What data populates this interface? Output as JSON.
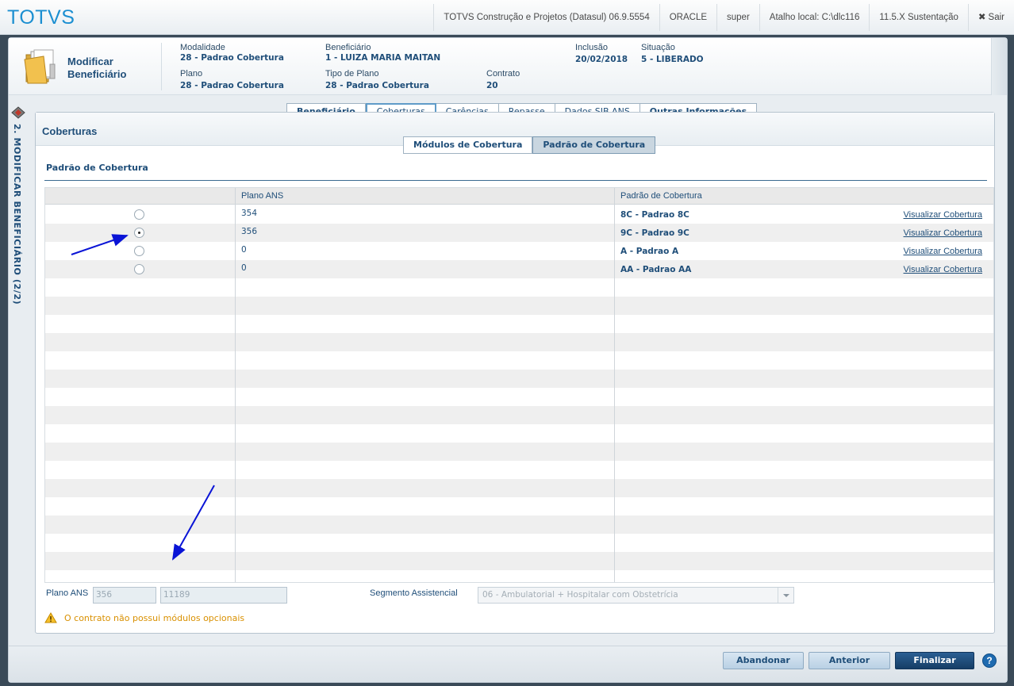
{
  "topbar": {
    "logo": "TOTVS",
    "items": [
      "TOTVS Construção e Projetos (Datasul) 06.9.5554",
      "ORACLE",
      "super",
      "Atalho local: C:\\dlc116",
      "11.5.X Sustentação"
    ],
    "exit_label": "Sair"
  },
  "header": {
    "title_line1": "Modificar",
    "title_line2": "Beneficiário",
    "fields": {
      "modalidade": {
        "label": "Modalidade",
        "value": "28 - Padrao Cobertura"
      },
      "beneficiario": {
        "label": "Beneficiário",
        "value": "1 - LUIZA MARIA MAITAN"
      },
      "inclusao": {
        "label": "Inclusão",
        "value": "20/02/2018"
      },
      "situacao": {
        "label": "Situação",
        "value": "5 - LIBERADO"
      },
      "plano": {
        "label": "Plano",
        "value": "28 - Padrao Cobertura"
      },
      "tipo_plano": {
        "label": "Tipo de Plano",
        "value": "28 - Padrao Cobertura"
      },
      "contrato": {
        "label": "Contrato",
        "value": "20"
      }
    }
  },
  "side": {
    "step_label": "2. MODIFICAR BENEFICIÁRIO (2/2)"
  },
  "tabs": [
    "Beneficiário",
    "Coberturas",
    "Carências",
    "Repasse",
    "Dados SIB ANS",
    "Outras Informações"
  ],
  "panel": {
    "title": "Coberturas",
    "subtabs": [
      "Módulos de Cobertura",
      "Padrão de Cobertura"
    ],
    "section_title": "Padrão de Cobertura"
  },
  "grid": {
    "headers": [
      "",
      "Plano ANS",
      "Padrão de Cobertura"
    ],
    "rows": [
      {
        "plano": "354",
        "padrao": "8C - Padrao 8C",
        "link": "Visualizar Cobertura",
        "selected": false
      },
      {
        "plano": "356",
        "padrao": "9C - Padrao 9C",
        "link": "Visualizar Cobertura",
        "selected": true
      },
      {
        "plano": "0",
        "padrao": "A - Padrao A",
        "link": "Visualizar Cobertura",
        "selected": false
      },
      {
        "plano": "0",
        "padrao": "AA - Padrao AA",
        "link": "Visualizar Cobertura",
        "selected": false
      }
    ]
  },
  "form": {
    "plano_ans_label": "Plano ANS",
    "plano_ans_value1": "356",
    "plano_ans_value2": "11189",
    "segmento_label": "Segmento Assistencial",
    "segmento_value": "06 - Ambulatorial + Hospitalar com Obstetrícia"
  },
  "warning": "O contrato não possui módulos opcionais",
  "footer": {
    "abandon_label": "Abandonar",
    "back_label": "Anterior",
    "finish_label": "Finalizar",
    "help_label": "?"
  },
  "colors": {
    "accent": "#1c8fd1",
    "text": "#1f4e79",
    "warning": "#d99000",
    "primary_button": "#1f4e79",
    "annotation_arrow": "#0a14d6"
  }
}
